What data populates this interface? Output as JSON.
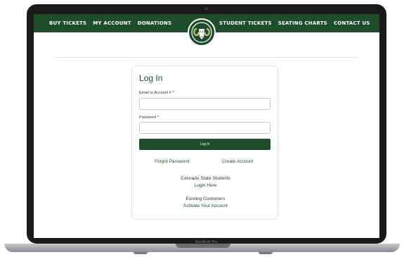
{
  "nav": {
    "left": [
      "BUY TICKETS",
      "MY ACCOUNT",
      "DONATIONS"
    ],
    "right": [
      "STUDENT TICKETS",
      "SEATING CHARTS",
      "CONTACT US"
    ]
  },
  "login": {
    "title": "Log In",
    "email_label": "Email or Account #",
    "password_label": "Password",
    "required_mark": "*",
    "submit_label": "Log In",
    "forgot_password": "Forgot Password",
    "create_account": "Create Account",
    "students_heading": "Colorado State Students",
    "students_link": "Login Here",
    "existing_heading": "Existing Customers",
    "existing_link": "Activate Your Account"
  },
  "device": {
    "label": "MacBook Pro"
  },
  "colors": {
    "brand_green": "#1e4d2b"
  }
}
